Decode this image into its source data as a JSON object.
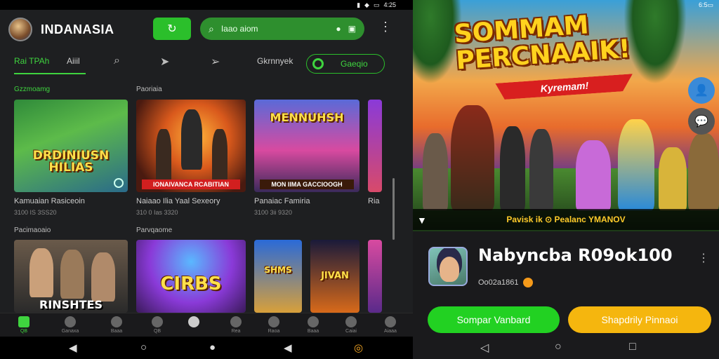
{
  "left": {
    "status": {
      "time": "4:25"
    },
    "app": {
      "brand": "INDANASIA",
      "search_text": "Iaao aiom"
    },
    "tabs": [
      {
        "label": "Rai TPAh"
      },
      {
        "label": "Aiiil"
      }
    ],
    "tab_extra": {
      "label": "Gkrnnyek"
    },
    "filter": {
      "label": "Gaeqio"
    },
    "sections": [
      {
        "label": "Gzzmoamg"
      },
      {
        "label": "Paoriaia"
      },
      {
        "label": "Pacimaoaio"
      },
      {
        "label": "Parvqaome"
      }
    ],
    "row1": [
      {
        "title": "DRDINIUSN HILIAS",
        "name": "Kamuaian Rasiceoin",
        "sub": "3100 IS 3SS20"
      },
      {
        "title": "",
        "banner": "IONAIVANCA RCABITIAN",
        "name": "Naiaao Ilia Yaal Sexeory",
        "sub": "310 0 Ias 3320"
      },
      {
        "title": "MENNUHSH",
        "banner": "MON IIMA GACCIOOGH",
        "name": "Panaiac Famiria",
        "sub": "3100 3ii 9320"
      },
      {
        "name": "Ria"
      }
    ],
    "row2": [
      {
        "title": "RINSHTES"
      },
      {
        "title": "CIRBS"
      },
      {
        "title": "SHMS"
      },
      {
        "title": "JIVAN"
      }
    ],
    "bottom_nav": [
      {
        "label": "QB"
      },
      {
        "label": "Ganaxa"
      },
      {
        "label": "Baaa"
      },
      {
        "label": "QB"
      },
      {
        "label": ""
      },
      {
        "label": "Rea"
      },
      {
        "label": "Raoa"
      },
      {
        "label": "Baaa"
      },
      {
        "label": "Caiai"
      },
      {
        "label": "Aiaaa"
      }
    ]
  },
  "right": {
    "status": {
      "time": "6:5"
    },
    "hero": {
      "title_line1": "SOMMAM",
      "title_line2": "PERCNAAIK!",
      "ribbon": "Kyremam!",
      "caption": "Pavisk ik ⊙ Pealanc YMANOV"
    },
    "app": {
      "name": "Nabyncba R09ok100",
      "meta": "Oo02a1861"
    },
    "buttons": {
      "primary": "Sompar Vanbard",
      "secondary": "Shapdrily Pinnaoi"
    }
  },
  "colors": {
    "accent_green": "#2bbf2b",
    "accent_yellow": "#f5b60e",
    "background": "#1e1f21"
  }
}
